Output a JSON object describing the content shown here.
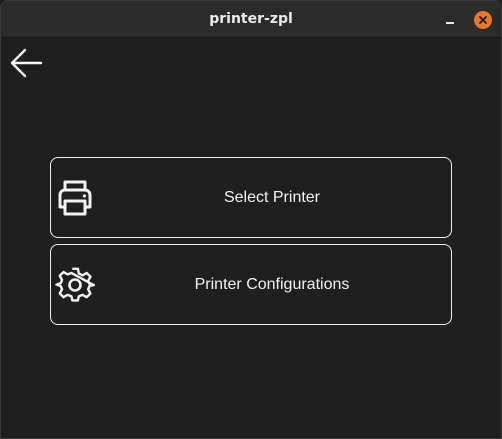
{
  "window": {
    "title": "printer-zpl"
  },
  "titlebar_icons": {
    "minimize": "minimize-icon",
    "close": "close-icon",
    "close_color": "#e9762a"
  },
  "nav": {
    "back_icon": "arrow-left-icon"
  },
  "menu": {
    "items": [
      {
        "label": "Select Printer",
        "icon": "printer-icon"
      },
      {
        "label": "Printer Configurations",
        "icon": "gear-icon"
      }
    ]
  }
}
